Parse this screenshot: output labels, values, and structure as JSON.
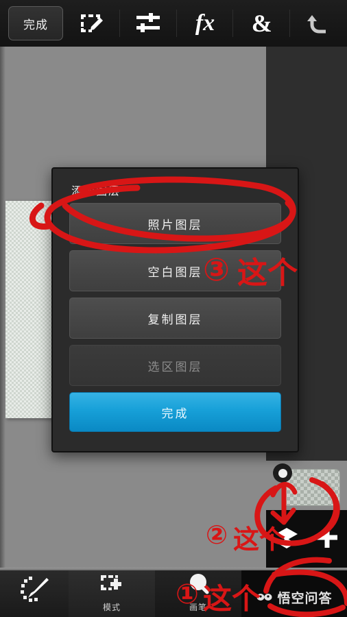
{
  "app": {
    "name": "photo-editor",
    "accent_blue": "#17a0d8",
    "annotation_red": "#d81616",
    "canvas_bg": "#8a8a8a",
    "panel_bg": "#2e2e2e",
    "toolbar_bg": "#191919"
  },
  "topbar": {
    "done_label": "完成",
    "tools": [
      {
        "name": "selection-edit-icon",
        "label": ""
      },
      {
        "name": "adjustments-icon",
        "label": ""
      },
      {
        "name": "effects-fx-icon",
        "label": "fx"
      },
      {
        "name": "ampersand-icon",
        "label": "&"
      },
      {
        "name": "undo-icon",
        "label": ""
      }
    ]
  },
  "dialog": {
    "title": "添加图层",
    "options": [
      {
        "label": "照片图层",
        "state": "enabled"
      },
      {
        "label": "空白图层",
        "state": "enabled"
      },
      {
        "label": "复制图层",
        "state": "enabled"
      },
      {
        "label": "选区图层",
        "state": "disabled"
      }
    ],
    "confirm_label": "完成"
  },
  "right_panel": {
    "layers_icon": "layers-icon",
    "add_icon": "plus-icon",
    "thumbnail": "layer-thumbnail-transparent",
    "visibility_toggle": "layer-visibility-dot"
  },
  "bottombar": {
    "items": [
      {
        "name": "brush-tool",
        "icon": "brush-icon",
        "label": ""
      },
      {
        "name": "mode-tool",
        "icon": "selection-add-icon",
        "label": "模式"
      },
      {
        "name": "pen-tool",
        "icon": "pen-icon",
        "label": "画笔"
      }
    ],
    "watermark": "悟空问答"
  },
  "annotations": [
    {
      "id": "step-1",
      "number": "①",
      "text": "这个",
      "target": "pen-tool"
    },
    {
      "id": "step-2",
      "number": "②",
      "text": "这个",
      "target": "add-layer-button"
    },
    {
      "id": "step-3",
      "number": "③",
      "text": "这个",
      "target": "photo-layer-option"
    }
  ]
}
